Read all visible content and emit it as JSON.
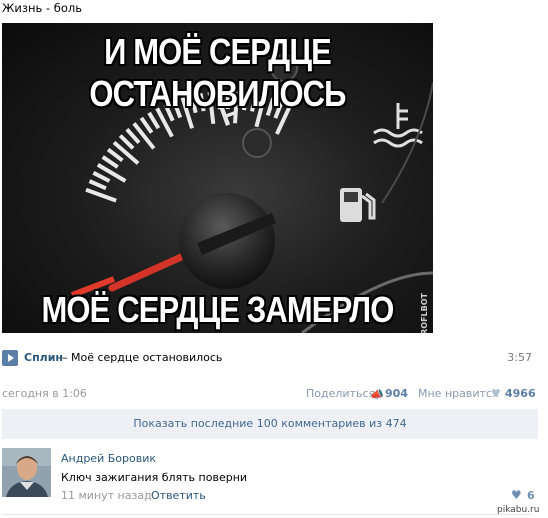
{
  "post": {
    "title": "Жизнь - боль"
  },
  "meme": {
    "top_text": "И МОЁ СЕРДЦЕ ОСТАНОВИЛОСЬ",
    "bottom_text": "МОЁ СЕРДЦЕ ЗАМЕРЛО",
    "watermark": "ROFLBOT",
    "gauge_letter": "F"
  },
  "audio": {
    "artist": "Сплин",
    "dash": " – ",
    "track": "Моё сердце остановилось",
    "duration": "3:57"
  },
  "meta": {
    "date": "сегодня в 1:06",
    "share_label": "Поделиться",
    "share_count": "904",
    "like_label": "Мне нравится",
    "like_count": "4966"
  },
  "comments": {
    "show_more": "Показать последние 100 комментариев из 474",
    "items": [
      {
        "author": "Андрей Боровик",
        "text": "Ключ зажигания блять поверни",
        "time": "11 минут назад",
        "separator": "|",
        "reply": "Ответить",
        "likes": "6"
      }
    ]
  },
  "footer": {
    "watermark": "pikabu.ru"
  }
}
